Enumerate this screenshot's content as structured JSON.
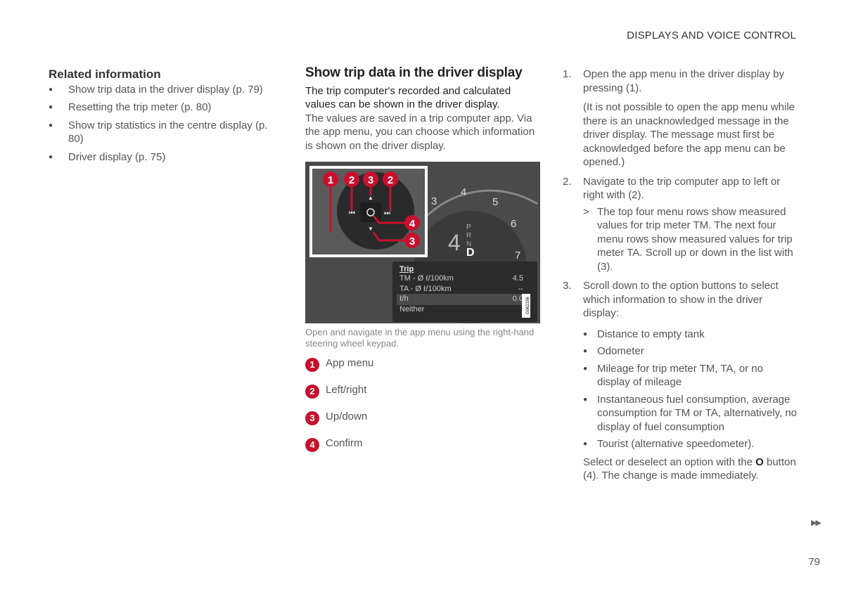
{
  "header": {
    "section": "DISPLAYS AND VOICE CONTROL"
  },
  "related": {
    "title": "Related information",
    "items": [
      "Show trip data in the driver display (p. 79)",
      "Resetting the trip meter (p. 80)",
      "Show trip statistics in the centre display (p. 80)",
      "Driver display (p. 75)"
    ]
  },
  "main": {
    "title": "Show trip data in the driver display",
    "lead": "The trip computer's recorded and calculated values can be shown in the driver display.",
    "body": "The values are saved in a trip computer app. Via the app menu, you can choose which information is shown on the driver display.",
    "figure": {
      "markers": [
        "1",
        "2",
        "3",
        "2",
        "4",
        "3"
      ],
      "gauge": [
        "3",
        "4",
        "5",
        "6",
        "7"
      ],
      "gear_big": "4",
      "gears": [
        "P",
        "R",
        "N",
        "D"
      ],
      "menu_title": "Trip",
      "menu_rows": [
        {
          "label": "TM - Ø ℓ/100km",
          "value": "4.5"
        },
        {
          "label": "TA - Ø ℓ/100km",
          "value": "--"
        },
        {
          "label": "ℓ/h",
          "value": "0.0"
        },
        {
          "label": "Neither",
          "value": ""
        }
      ],
      "code": "G062156"
    },
    "caption": "Open and navigate in the app menu using the right-hand steering wheel keypad.",
    "legend": [
      {
        "n": "1",
        "label": "App menu"
      },
      {
        "n": "2",
        "label": "Left/right"
      },
      {
        "n": "3",
        "label": "Up/down"
      },
      {
        "n": "4",
        "label": "Confirm"
      }
    ]
  },
  "steps": [
    {
      "n": "1.",
      "text": "Open the app menu in the driver display by pressing (1).",
      "note": "(It is not possible to open the app menu while there is an unacknowledged message in the driver display. The message must first be acknowledged before the app menu can be opened.)"
    },
    {
      "n": "2.",
      "text": "Navigate to the trip computer app to left or right with (2).",
      "result_mark": ">",
      "result": "The top four menu rows show measured values for trip meter TM. The next four menu rows show measured values for trip meter TA. Scroll up or down in the list with (3)."
    },
    {
      "n": "3.",
      "text": "Scroll down to the option buttons to select which information to show in the driver display:",
      "options": [
        "Distance to empty tank",
        "Odometer",
        "Mileage for trip meter TM, TA, or no display of mileage",
        "Instantaneous fuel consumption, average consumption for TM or TA, alternatively, no display of fuel consumption",
        "Tourist (alternative speedometer)."
      ],
      "final_pre": "Select or deselect an option with the ",
      "final_button": "O",
      "final_post": " button (4). The change is made immediately."
    }
  ],
  "footer": {
    "continue_icon": "double-triangle-right-icon",
    "continue_glyph": "▶▶",
    "page": "79"
  },
  "colors": {
    "marker": "#c8102e"
  }
}
